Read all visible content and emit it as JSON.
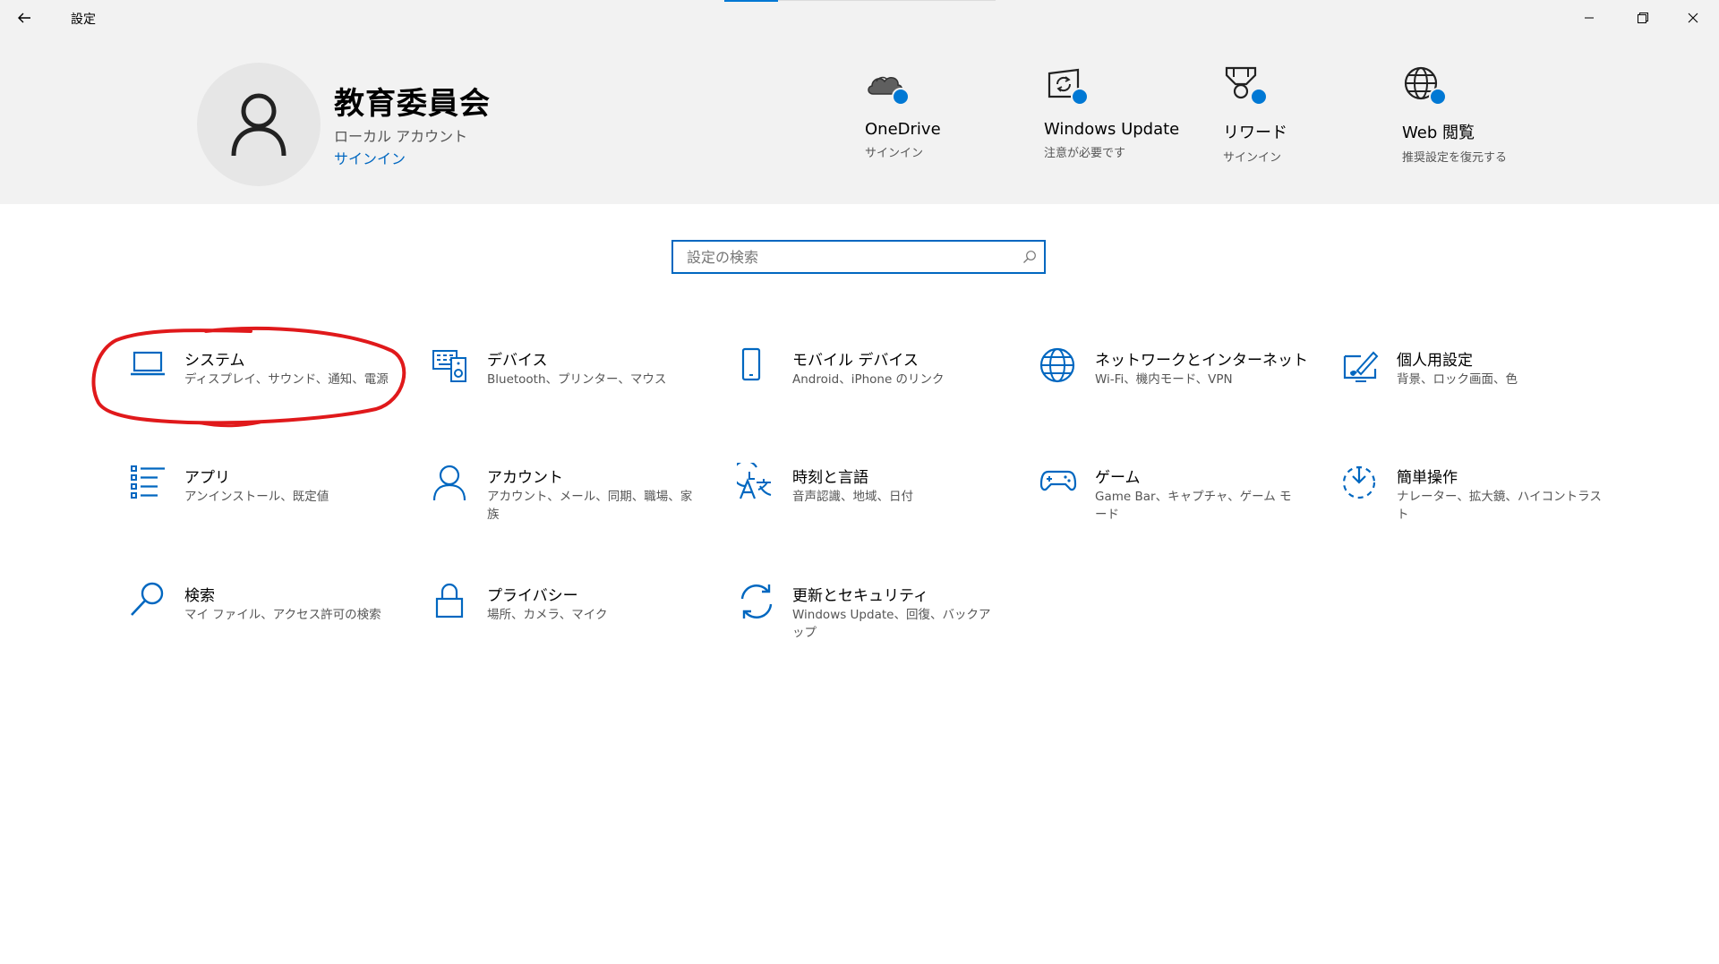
{
  "window": {
    "title": "設定",
    "back_icon": "arrow-left-icon",
    "controls": [
      "minimize-icon",
      "maximize-icon",
      "close-icon"
    ]
  },
  "profile": {
    "name": "教育委員会",
    "account_type": "ローカル アカウント",
    "signin_link": "サインイン"
  },
  "quick_status": [
    {
      "title": "OneDrive",
      "sub": "サインイン",
      "icon": "onedrive-cloud-icon"
    },
    {
      "title": "Windows Update",
      "sub": "注意が必要です",
      "icon": "windows-update-icon"
    },
    {
      "title": "リワード",
      "sub": "サインイン",
      "icon": "rewards-trophy-icon"
    },
    {
      "title": "Web 閲覧",
      "sub": "推奨設定を復元する",
      "icon": "globe-icon"
    }
  ],
  "search": {
    "placeholder": "設定の検索",
    "value": ""
  },
  "categories": [
    {
      "title": "システム",
      "desc": "ディスプレイ、サウンド、通知、電源",
      "icon": "laptop-icon"
    },
    {
      "title": "デバイス",
      "desc": "Bluetooth、プリンター、マウス",
      "icon": "keyboard-speaker-icon"
    },
    {
      "title": "モバイル デバイス",
      "desc": "Android、iPhone のリンク",
      "icon": "phone-icon"
    },
    {
      "title": "ネットワークとインターネット",
      "desc": "Wi-Fi、機内モード、VPN",
      "icon": "globe-network-icon"
    },
    {
      "title": "個人用設定",
      "desc": "背景、ロック画面、色",
      "icon": "personalize-pen-icon"
    },
    {
      "title": "アプリ",
      "desc": "アンインストール、既定値",
      "icon": "apps-list-icon"
    },
    {
      "title": "アカウント",
      "desc": "アカウント、メール、同期、職場、家族",
      "icon": "person-icon"
    },
    {
      "title": "時刻と言語",
      "desc": "音声認識、地域、日付",
      "icon": "time-language-icon"
    },
    {
      "title": "ゲーム",
      "desc": "Game Bar、キャプチャ、ゲーム モード",
      "icon": "gamepad-icon"
    },
    {
      "title": "簡単操作",
      "desc": "ナレーター、拡大鏡、ハイコントラスト",
      "icon": "ease-of-access-icon"
    },
    {
      "title": "検索",
      "desc": "マイ ファイル、アクセス許可の検索",
      "icon": "search-magnifier-icon"
    },
    {
      "title": "プライバシー",
      "desc": "場所、カメラ、マイク",
      "icon": "lock-icon"
    },
    {
      "title": "更新とセキュリティ",
      "desc": "Windows Update、回復、バックアップ",
      "icon": "sync-arrows-icon"
    }
  ],
  "annotation": {
    "highlight_color": "#e0191b",
    "target": "システム"
  },
  "colors": {
    "accent": "#0078d4",
    "header_bg": "#f2f2f2",
    "link": "#0067c0"
  }
}
